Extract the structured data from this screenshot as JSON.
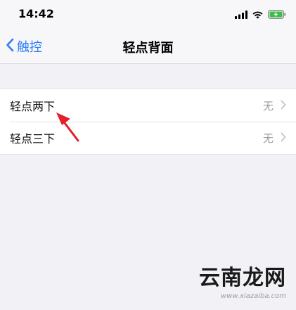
{
  "status_bar": {
    "time": "14:42"
  },
  "nav": {
    "back_label": "触控",
    "title": "轻点背面"
  },
  "list": {
    "items": [
      {
        "label": "轻点两下",
        "value": "无"
      },
      {
        "label": "轻点三下",
        "value": "无"
      }
    ]
  },
  "watermark": {
    "logo": "云南龙网",
    "url": "www.xiazaiba.com"
  },
  "colors": {
    "accent": "#2f7cf6",
    "arrow": "#e0202a",
    "battery": "#3cc04a"
  },
  "icons": {
    "cellular": "cellular-signal-icon",
    "wifi": "wifi-icon",
    "battery": "battery-charging-icon",
    "back": "chevron-left-icon",
    "disclosure": "chevron-right-icon"
  }
}
